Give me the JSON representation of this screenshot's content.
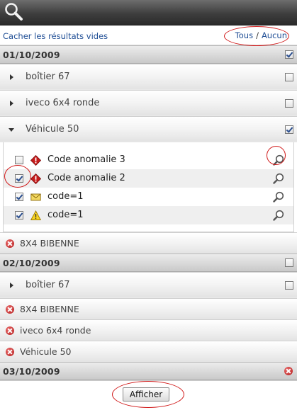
{
  "toolbar": {
    "hide_empty": "Cacher les résultats vides",
    "all": "Tous",
    "separator": "/",
    "none": "Aucun"
  },
  "dates": [
    {
      "label": "01/10/2009",
      "checked": true,
      "groups": [
        {
          "label": "boîtier 67",
          "expanded": false,
          "checked": false
        },
        {
          "label": "iveco 6x4 ronde",
          "expanded": false,
          "checked": false
        },
        {
          "label": "Véhicule 50",
          "expanded": true,
          "checked": true,
          "items": [
            {
              "label": "Code anomalie 3",
              "icon": "alert-icon",
              "checked": false
            },
            {
              "label": "Code anomalie 2",
              "icon": "alert-icon",
              "checked": true
            },
            {
              "label": "code=1",
              "icon": "envelope-icon",
              "checked": true
            },
            {
              "label": "code=1",
              "icon": "warning-icon",
              "checked": true
            }
          ]
        }
      ],
      "errors": [
        "8X4 BIBENNE"
      ]
    },
    {
      "label": "02/10/2009",
      "checked": false,
      "groups": [
        {
          "label": "boîtier 67",
          "expanded": false,
          "checked": false
        }
      ],
      "errors": [
        "8X4 BIBENNE",
        "iveco 6x4 ronde",
        "Véhicule 50"
      ]
    },
    {
      "label": "03/10/2009",
      "status": "error"
    }
  ],
  "footer": {
    "show_button": "Afficher"
  },
  "colors": {
    "link": "#1f4e95",
    "annotation": "#d01818",
    "error": "#b51d1d"
  }
}
